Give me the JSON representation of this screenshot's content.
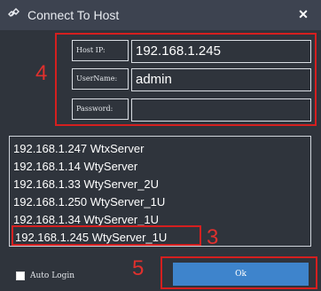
{
  "window": {
    "title": "Connect To Host",
    "title_icon": "link-icon",
    "close_icon": "close-icon"
  },
  "form": {
    "host_ip_label": "Host IP:",
    "host_ip_value": "192.168.1.245",
    "username_label": "UserName:",
    "username_value": "admin",
    "password_label": "Password:",
    "password_value": ""
  },
  "host_list": {
    "items": [
      "192.168.1.247 WtxServer",
      "192.168.1.14 WtyServer",
      "192.168.1.33 WtyServer_2U",
      "192.168.1.250 WtyServer_1U",
      "192.168.1.34 WtyServer_1U",
      "192.168.1.245 WtyServer_1U"
    ],
    "selected_index": 5
  },
  "auto_login": {
    "label": "Auto Login",
    "checked": false
  },
  "ok_button": {
    "label": "Ok"
  },
  "annotations": {
    "form_number": "4",
    "selected_number": "3",
    "ok_number": "5",
    "color": "#d51f1f"
  }
}
